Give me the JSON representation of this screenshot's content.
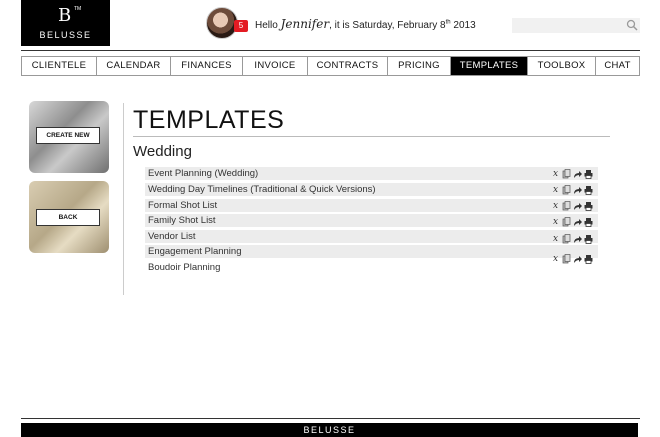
{
  "brand": {
    "mark": "B",
    "tm": "TM",
    "name": "BELUSSE"
  },
  "header": {
    "notification_count": "5",
    "greeting_prefix": "Hello",
    "user_name": "Jennifer",
    "greeting_mid": ", it is",
    "date_text": "Saturday, February 8",
    "date_suffix": "th",
    "year": "2013",
    "search": {
      "placeholder": "",
      "value": ""
    }
  },
  "nav": {
    "tabs": [
      {
        "label": "CLIENTELE"
      },
      {
        "label": "CALENDAR"
      },
      {
        "label": "FINANCES"
      },
      {
        "label": "INVOICE"
      },
      {
        "label": "CONTRACTS"
      },
      {
        "label": "PRICING"
      },
      {
        "label": "TEMPLATES",
        "active": true
      },
      {
        "label": "TOOLBOX"
      },
      {
        "label": "CHAT"
      }
    ]
  },
  "sidebar": {
    "create_new_label": "CREATE NEW",
    "back_label": "BACK"
  },
  "main": {
    "title": "TEMPLATES",
    "section": "Wedding",
    "items": [
      {
        "label": "Event Planning (Wedding)"
      },
      {
        "label": "Wedding Day Timelines (Traditional & Quick Versions)"
      },
      {
        "label": "Formal Shot List"
      },
      {
        "label": "Family Shot List"
      },
      {
        "label": "Vendor List"
      },
      {
        "label": "Engagement Planning"
      },
      {
        "label": "Boudoir Planning"
      }
    ],
    "action_icons": [
      "delete-x-icon",
      "copy-icon",
      "share-arrow-icon",
      "print-icon"
    ],
    "action_glyphs": {
      "delete": "x"
    }
  },
  "footer": {
    "brand": "BELUSSE"
  },
  "colors": {
    "active_tab": "#000000",
    "notification": "#e31b23",
    "row_shade": "#ececec"
  }
}
